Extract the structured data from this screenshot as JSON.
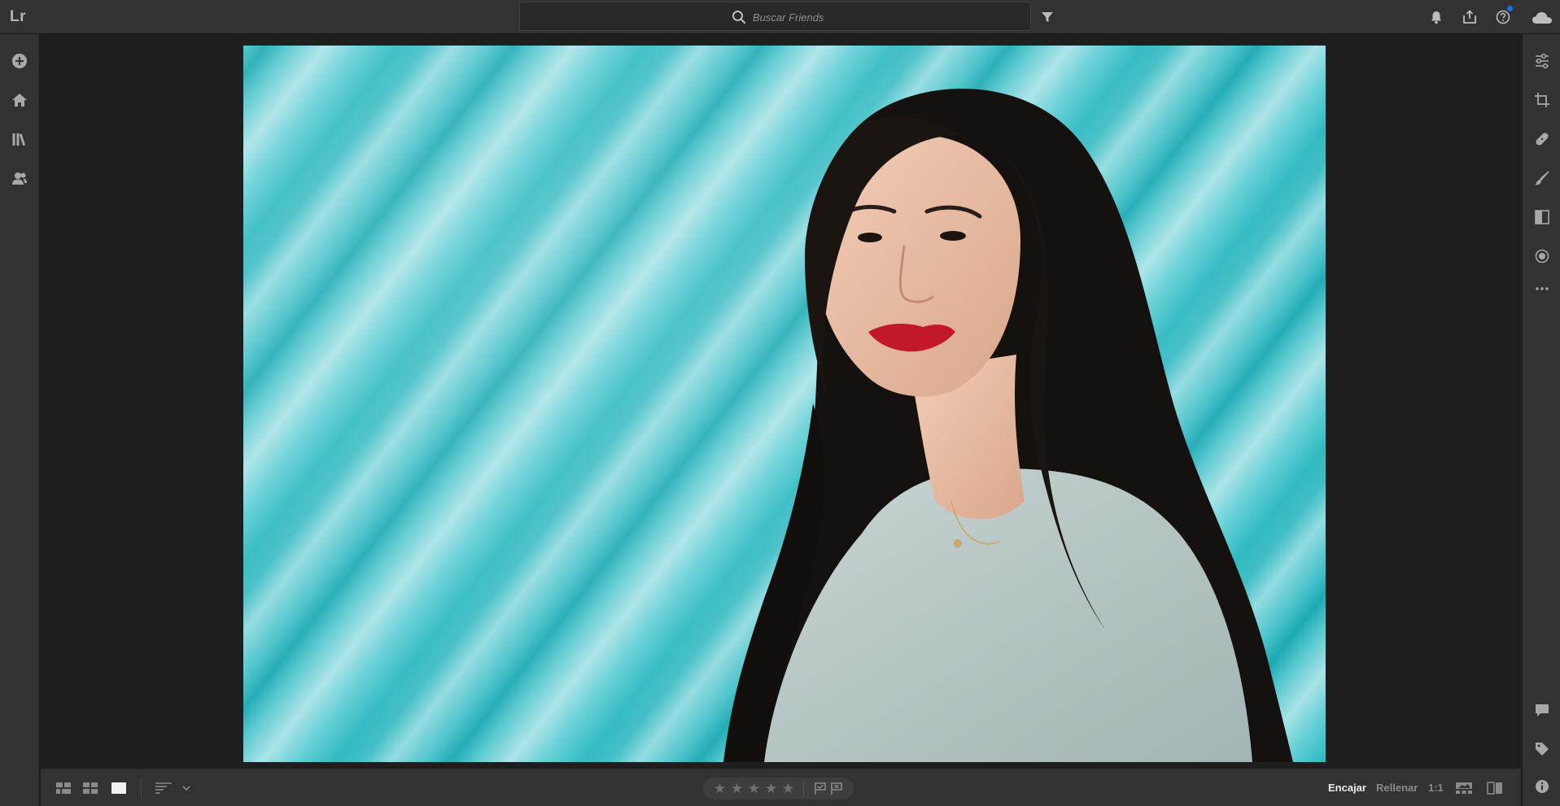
{
  "app": {
    "logo": "Lr"
  },
  "search": {
    "placeholder": "Buscar Friends",
    "value": ""
  },
  "topbar": {
    "icons": [
      "filter-icon",
      "bell-icon",
      "share-icon",
      "help-icon",
      "cloud-icon"
    ],
    "help_has_notification": true
  },
  "left_rail": {
    "items": [
      "add-photos-icon",
      "home-icon",
      "library-icon",
      "people-icon"
    ]
  },
  "right_rail": {
    "top_items": [
      "edit-sliders-icon",
      "crop-icon",
      "healing-icon",
      "brush-icon",
      "linear-gradient-icon",
      "radial-gradient-icon",
      "more-icon"
    ],
    "bottom_items": [
      "comments-icon",
      "tag-icon",
      "info-icon"
    ]
  },
  "bottom_bar": {
    "view_modes": [
      "square-grid-icon",
      "detail-grid-icon",
      "single-view-icon"
    ],
    "sort_icon": "sort-icon",
    "rating": {
      "stars": 5,
      "value": 0
    },
    "flags": [
      "pick-flag-icon",
      "reject-flag-icon"
    ],
    "zoom": {
      "fit": "Encajar",
      "fill": "Rellenar",
      "one_to_one": "1:1"
    },
    "right_icons": [
      "filmstrip-icon",
      "compare-icon"
    ]
  },
  "colors": {
    "accent": "#1473e6",
    "panel": "#323232",
    "background": "#1e1e1e",
    "photo_backdrop": "#2bb8c0"
  }
}
